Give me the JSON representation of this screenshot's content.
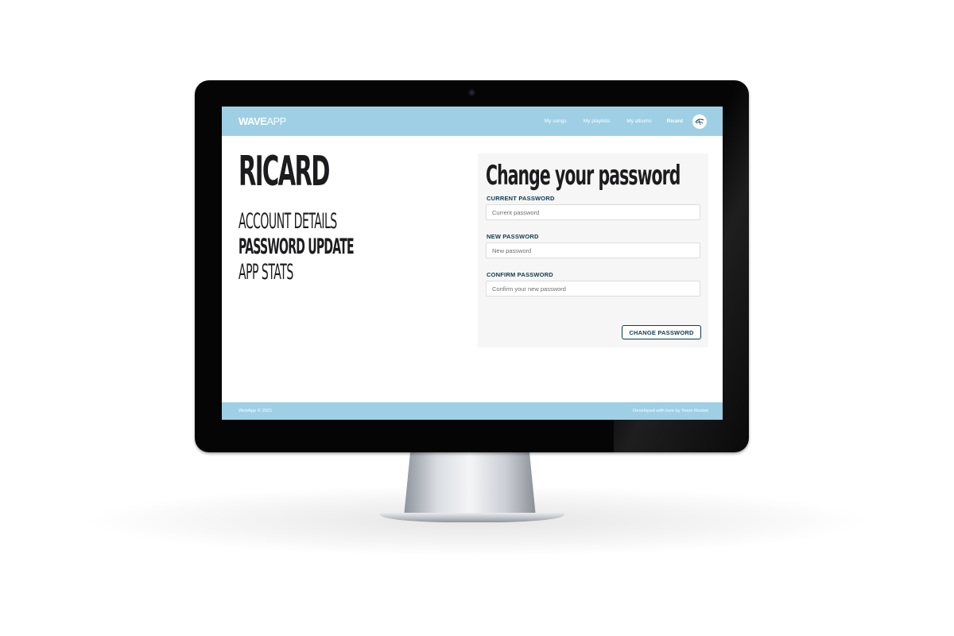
{
  "navbar": {
    "logo_bold": "WAVE",
    "logo_light": "APP",
    "links": [
      "My songs",
      "My playlists",
      "My albums"
    ],
    "username": "Ricard",
    "avatar_icon": "user-avatar-icon"
  },
  "profile": {
    "name": "RICARD",
    "menu": {
      "account_details": "ACCOUNT DETAILS",
      "password_update": "PASSWORD UPDATE",
      "app_stats": "APP STATS"
    }
  },
  "password_form": {
    "title": "Change your password",
    "current_label": "CURRENT PASSWORD",
    "current_placeholder": "Current password",
    "new_label": "NEW PASSWORD",
    "new_placeholder": "New password",
    "confirm_label": "CONFIRM PASSWORD",
    "confirm_placeholder": "Confirm your new password",
    "submit_label": "CHANGE PASSWORD"
  },
  "footer": {
    "left": "WebApp © 2021",
    "right": "Developed with love by Team Rocket"
  },
  "colors": {
    "accent": "#9fcfe4",
    "brand_dark": "#0f3a4e",
    "text_dark": "#1c1c1e"
  }
}
